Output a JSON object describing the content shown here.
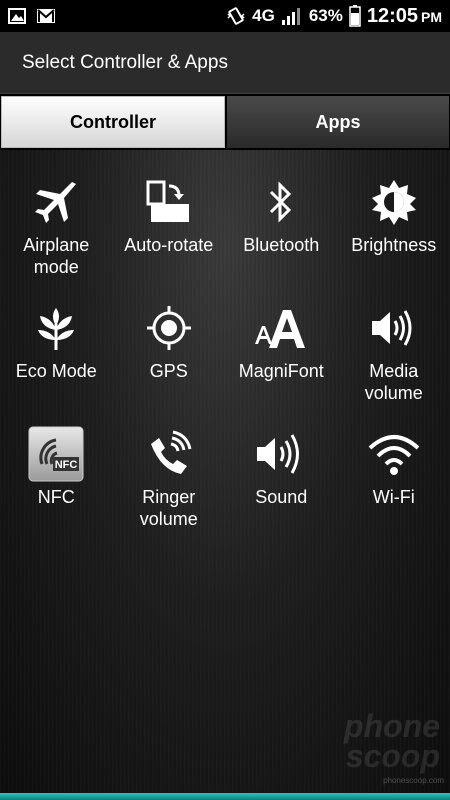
{
  "status_bar": {
    "network": "4G",
    "battery": "63%",
    "time": "12:05",
    "ampm": "PM",
    "icons": [
      "gallery-icon",
      "gmail-icon",
      "vibrate-icon",
      "lte-icon",
      "signal-icon",
      "battery-icon"
    ]
  },
  "title": "Select Controller & Apps",
  "tabs": [
    {
      "label": "Controller",
      "active": true
    },
    {
      "label": "Apps",
      "active": false
    }
  ],
  "tiles": [
    {
      "label": "Airplane mode",
      "icon": "airplane-icon"
    },
    {
      "label": "Auto-rotate",
      "icon": "auto-rotate-icon"
    },
    {
      "label": "Bluetooth",
      "icon": "bluetooth-icon"
    },
    {
      "label": "Brightness",
      "icon": "brightness-icon"
    },
    {
      "label": "Eco Mode",
      "icon": "eco-leaf-icon"
    },
    {
      "label": "GPS",
      "icon": "gps-icon"
    },
    {
      "label": "MagniFont",
      "icon": "magnifont-icon"
    },
    {
      "label": "Media volume",
      "icon": "media-volume-icon"
    },
    {
      "label": "NFC",
      "icon": "nfc-icon"
    },
    {
      "label": "Ringer volume",
      "icon": "ringer-icon"
    },
    {
      "label": "Sound",
      "icon": "sound-icon"
    },
    {
      "label": "Wi-Fi",
      "icon": "wifi-icon"
    }
  ],
  "watermark": {
    "line1": "phone",
    "line2": "scoop",
    "url": "phonescoop.com"
  }
}
